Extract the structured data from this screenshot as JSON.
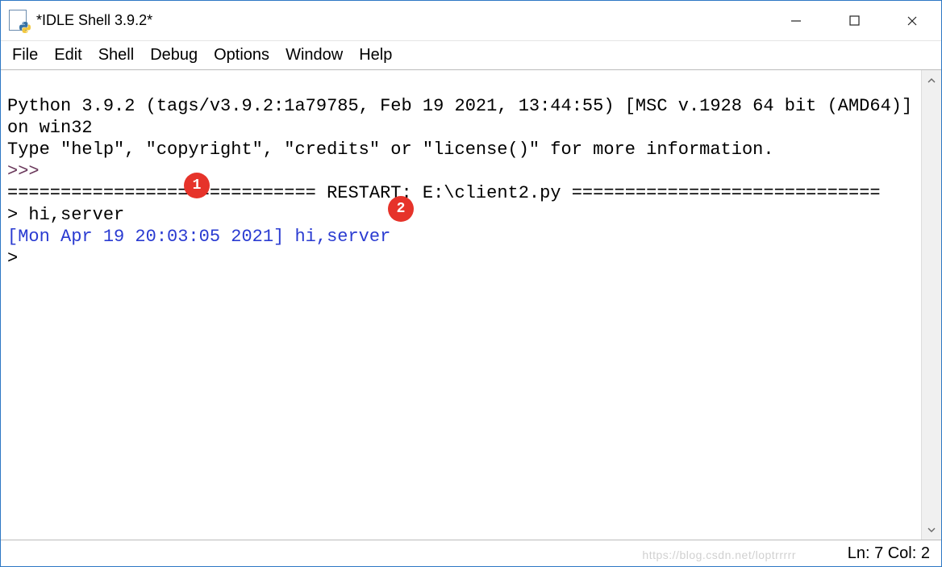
{
  "window": {
    "title": "*IDLE Shell 3.9.2*"
  },
  "menu": {
    "items": [
      "File",
      "Edit",
      "Shell",
      "Debug",
      "Options",
      "Window",
      "Help"
    ]
  },
  "shell": {
    "banner_line1": "Python 3.9.2 (tags/v3.9.2:1a79785, Feb 19 2021, 13:44:55) [MSC v.1928 64 bit (AMD64)] on win32",
    "banner_line2": "Type \"help\", \"copyright\", \"credits\" or \"license()\" for more information.",
    "prompt1": ">>> ",
    "restart_left": "============================= ",
    "restart_label": "RESTART: E:\\client2.py",
    "restart_right": " =============================",
    "input_line": "> hi,server",
    "response_line": "[Mon Apr 19 20:03:05 2021] hi,server",
    "prompt2": "> "
  },
  "annotations": {
    "badge1": "1",
    "badge2": "2"
  },
  "status": {
    "text": "Ln: 7  Col: 2",
    "watermark": "https://blog.csdn.net/loptrrrrr"
  }
}
